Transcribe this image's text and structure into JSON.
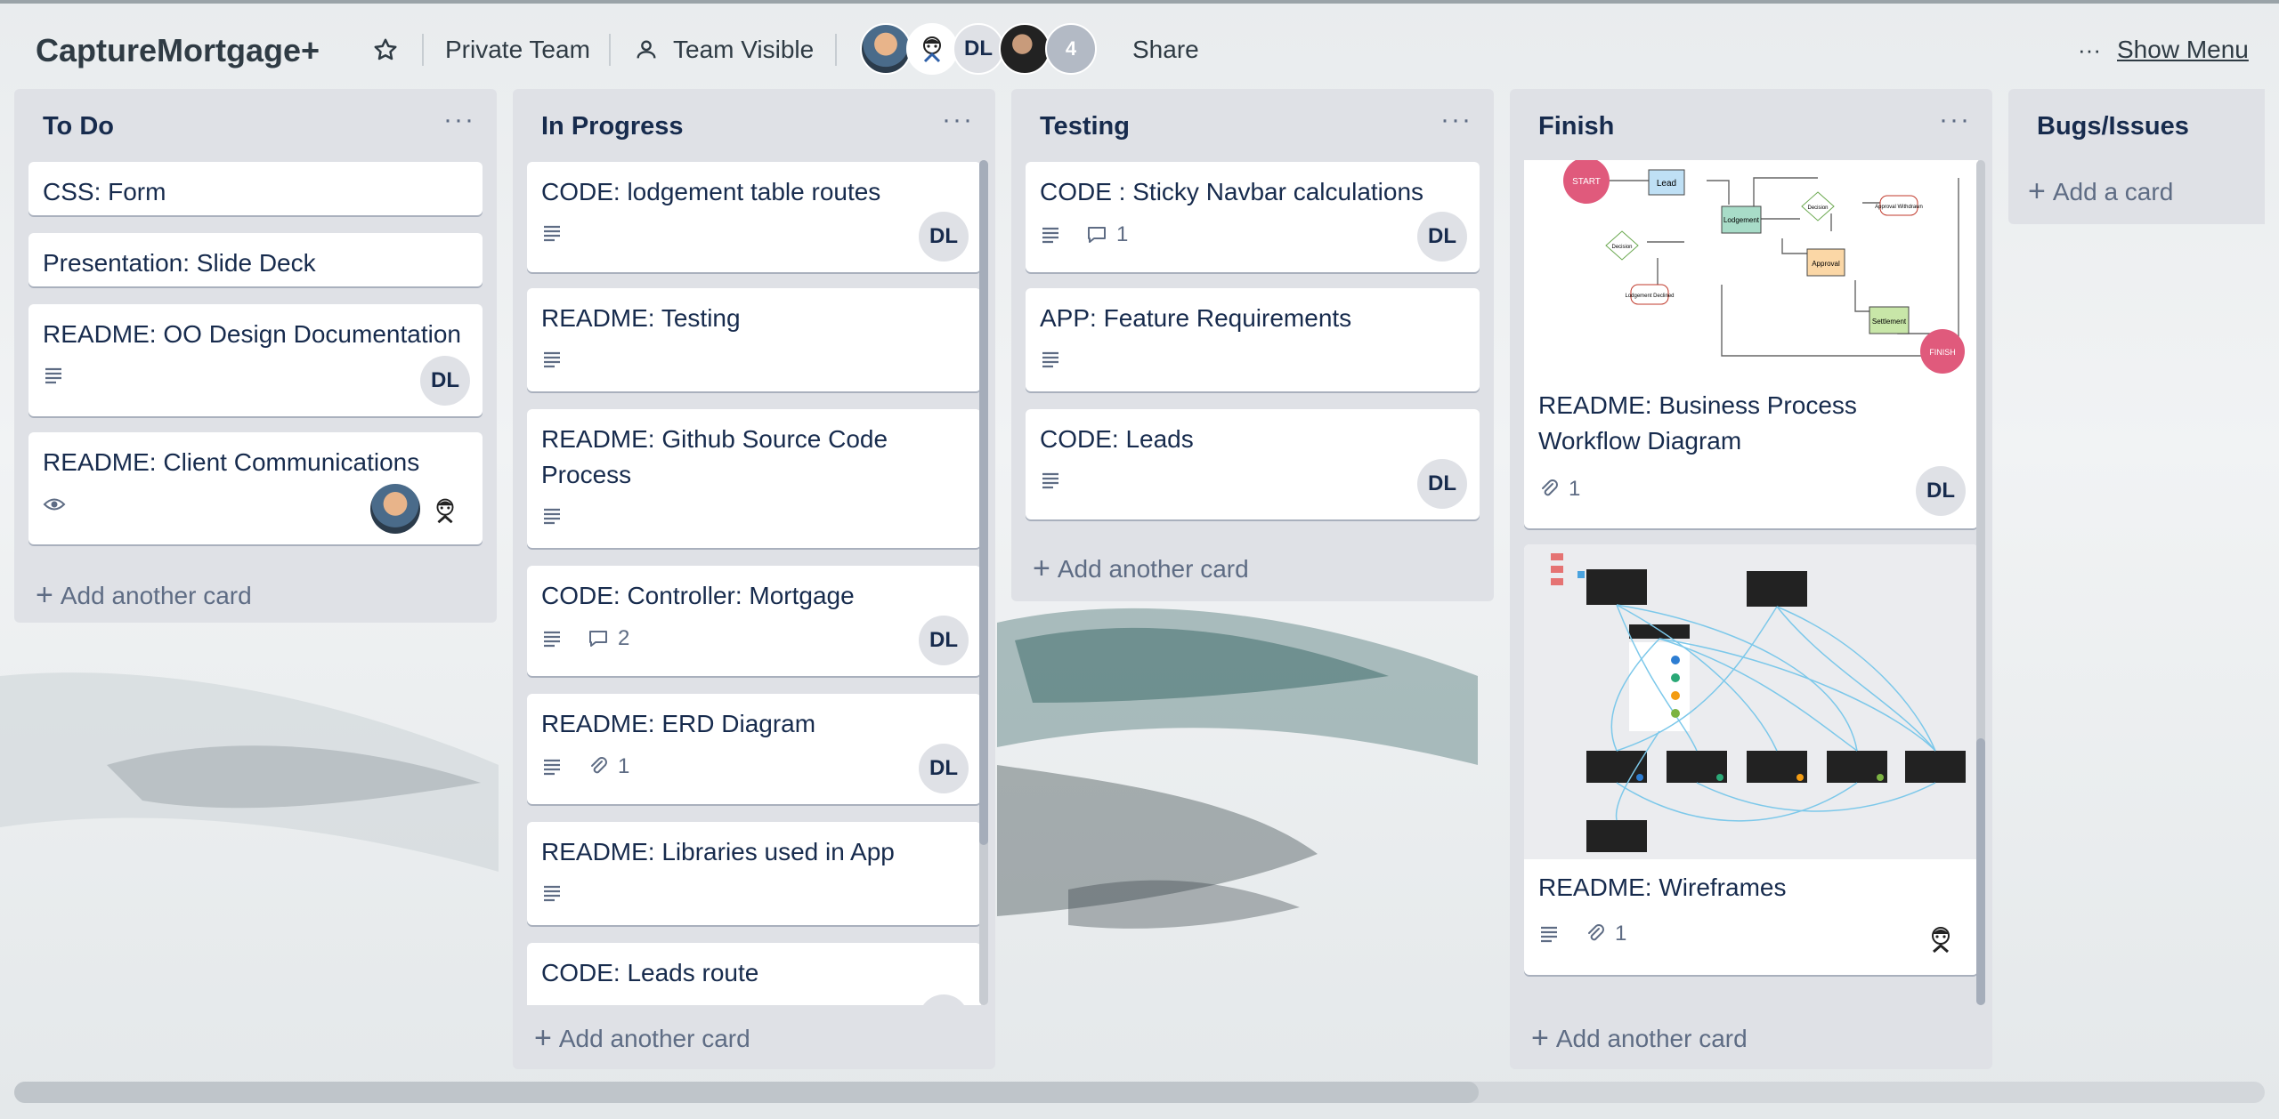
{
  "header": {
    "title": "CaptureMortgage+",
    "star_icon": "star-icon",
    "visibility_private": "Private Team",
    "visibility_team": "Team Visible",
    "member_initials": "DL",
    "member_overflow": "4",
    "share": "Share",
    "more": "···",
    "show_menu": "Show Menu"
  },
  "lists": {
    "todo": {
      "title": "To Do",
      "cards": [
        {
          "title": "CSS: Form"
        },
        {
          "title": "Presentation: Slide Deck"
        },
        {
          "title": "README: OO Design Documentation",
          "member": "DL"
        },
        {
          "title": "README: Client Communications"
        }
      ],
      "add": "Add another card"
    },
    "inprogress": {
      "title": "In Progress",
      "cards": [
        {
          "title": "CODE: lodgement table routes",
          "member": "DL"
        },
        {
          "title": "README: Testing"
        },
        {
          "title": "README: Github Source Code Process"
        },
        {
          "title": "CODE: Controller: Mortgage",
          "comments": "2",
          "member": "DL"
        },
        {
          "title": "README: ERD Diagram",
          "attachments": "1",
          "member": "DL"
        },
        {
          "title": "README: Libraries used in App"
        },
        {
          "title": "CODE: Leads route"
        }
      ],
      "add": "Add another card"
    },
    "testing": {
      "title": "Testing",
      "cards": [
        {
          "title": "CODE : Sticky Navbar calculations",
          "comments": "1",
          "member": "DL"
        },
        {
          "title": "APP: Feature Requirements"
        },
        {
          "title": "CODE: Leads",
          "member": "DL"
        }
      ],
      "add": "Add another card"
    },
    "finish": {
      "title": "Finish",
      "cards": [
        {
          "title": "README: Business Process Workflow Diagram",
          "attachments": "1",
          "member": "DL",
          "diagram": {
            "start": "START",
            "lead": "Lead",
            "lodgement": "Lodgement",
            "approval": "Approval",
            "settlement": "Settlement",
            "finish": "FINISH",
            "decision_a": "Decision",
            "decision_b": "Decision",
            "lodgement_declined": "Lodgement Declined",
            "approval_withdrawn": "Approval Withdrawn"
          }
        },
        {
          "title": "README: Wireframes",
          "attachments": "1"
        }
      ],
      "add": "Add another card"
    },
    "bugs": {
      "title": "Bugs/Issues",
      "add": "Add a card"
    }
  },
  "colors": {
    "list_bg": "#dfe1e6",
    "card_bg": "#ffffff",
    "text": "#172b4d",
    "muted": "#5e6c84",
    "start_node": "#e05a7c",
    "lead_node": "#bfe0f5",
    "lodgement_node": "#a8dcc8",
    "approval_node": "#fbd7a6",
    "settlement_node": "#c8e6a8"
  }
}
